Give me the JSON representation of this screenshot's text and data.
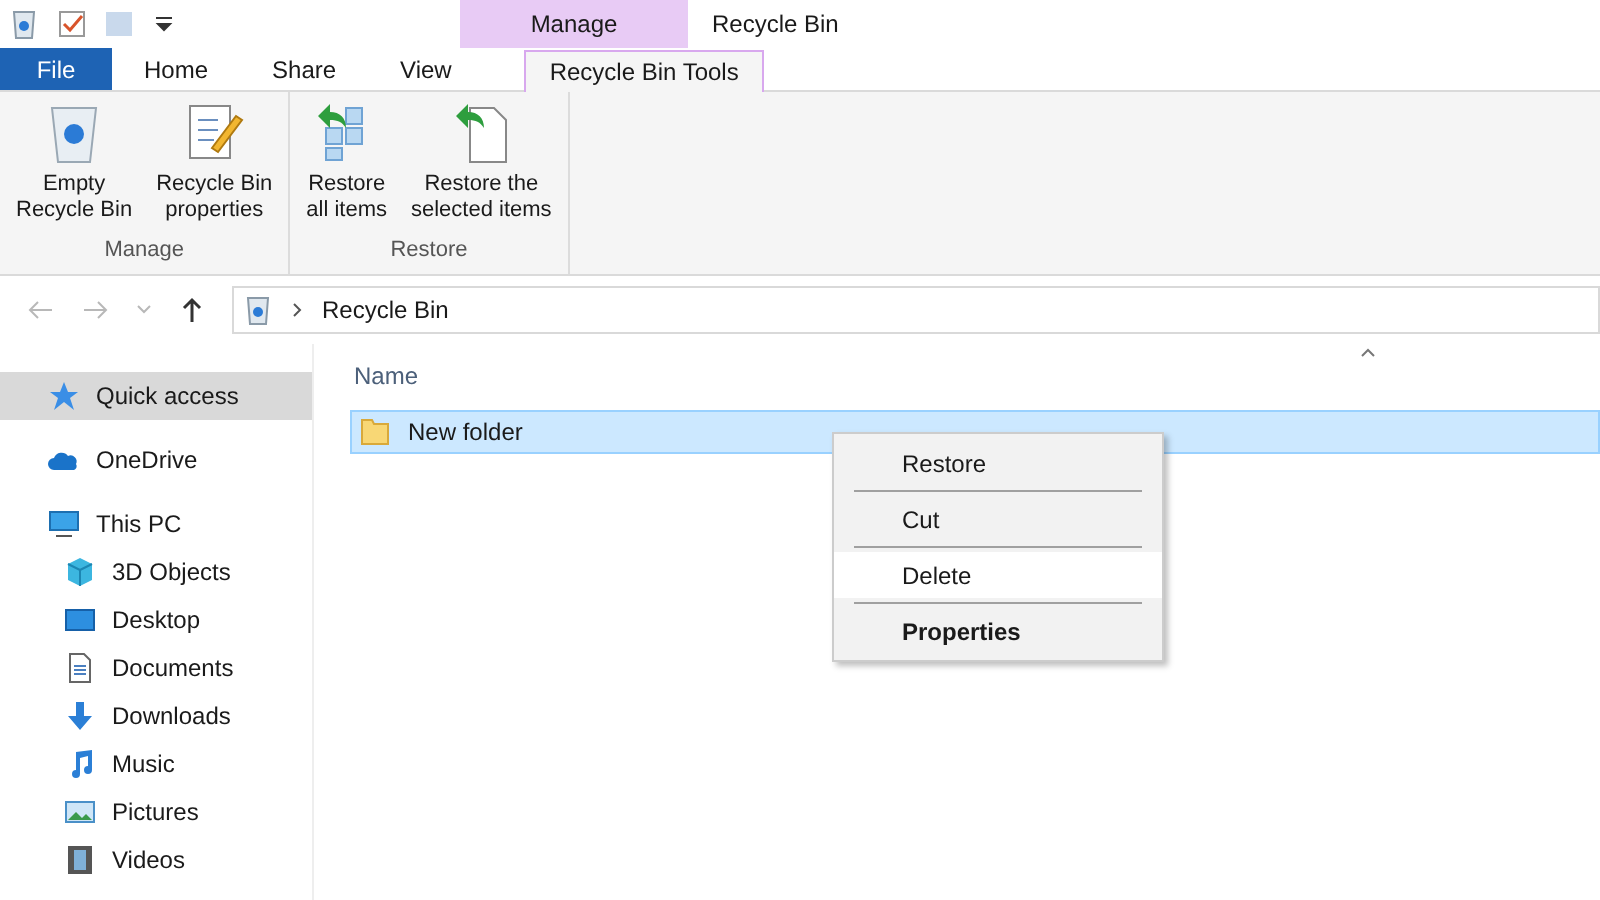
{
  "ribbon_context": {
    "group_label": "Manage",
    "window_title": "Recycle Bin"
  },
  "tabs": [
    {
      "label": "File",
      "kind": "file",
      "selected": false
    },
    {
      "label": "Home",
      "kind": "tab",
      "selected": false
    },
    {
      "label": "Share",
      "kind": "tab",
      "selected": false
    },
    {
      "label": "View",
      "kind": "tab",
      "selected": false
    },
    {
      "label": "Recycle Bin Tools",
      "kind": "tab",
      "selected": true
    }
  ],
  "ribbon_groups": [
    {
      "label": "Manage",
      "buttons": [
        {
          "label": "Empty\nRecycle Bin",
          "kind": "bin"
        },
        {
          "label": "Recycle Bin\nproperties",
          "kind": "props"
        }
      ]
    },
    {
      "label": "Restore",
      "buttons": [
        {
          "label": "Restore\nall items",
          "kind": "restore_all"
        },
        {
          "label": "Restore the\nselected items",
          "kind": "restore_sel"
        }
      ]
    }
  ],
  "address": {
    "path": "Recycle Bin"
  },
  "sidebar": {
    "items": [
      {
        "label": "Quick access",
        "kind": "star",
        "selected": true
      },
      {
        "label": "OneDrive",
        "kind": "cloud",
        "selected": false
      },
      {
        "label": "This PC",
        "kind": "pc",
        "selected": false,
        "children": [
          {
            "label": "3D Objects",
            "kind": "cube",
            "selected": false
          },
          {
            "label": "Desktop",
            "kind": "desktop",
            "selected": false
          },
          {
            "label": "Documents",
            "kind": "doc",
            "selected": false
          },
          {
            "label": "Downloads",
            "kind": "down",
            "selected": false
          },
          {
            "label": "Music",
            "kind": "music",
            "selected": false
          },
          {
            "label": "Pictures",
            "kind": "pic",
            "selected": false
          },
          {
            "label": "Videos",
            "kind": "video",
            "selected": false
          }
        ]
      }
    ]
  },
  "file_list": {
    "columns": [
      "Name"
    ],
    "rows": [
      {
        "name": "New folder",
        "selected": true
      }
    ]
  },
  "context_menu": {
    "items": [
      {
        "label": "Restore",
        "selected": false,
        "kind": "normal"
      },
      {
        "label": "Cut",
        "selected": false,
        "kind": "normal"
      },
      {
        "label": "Delete",
        "selected": true,
        "kind": "normal"
      },
      {
        "label": "Properties",
        "selected": false,
        "kind": "default"
      }
    ]
  }
}
